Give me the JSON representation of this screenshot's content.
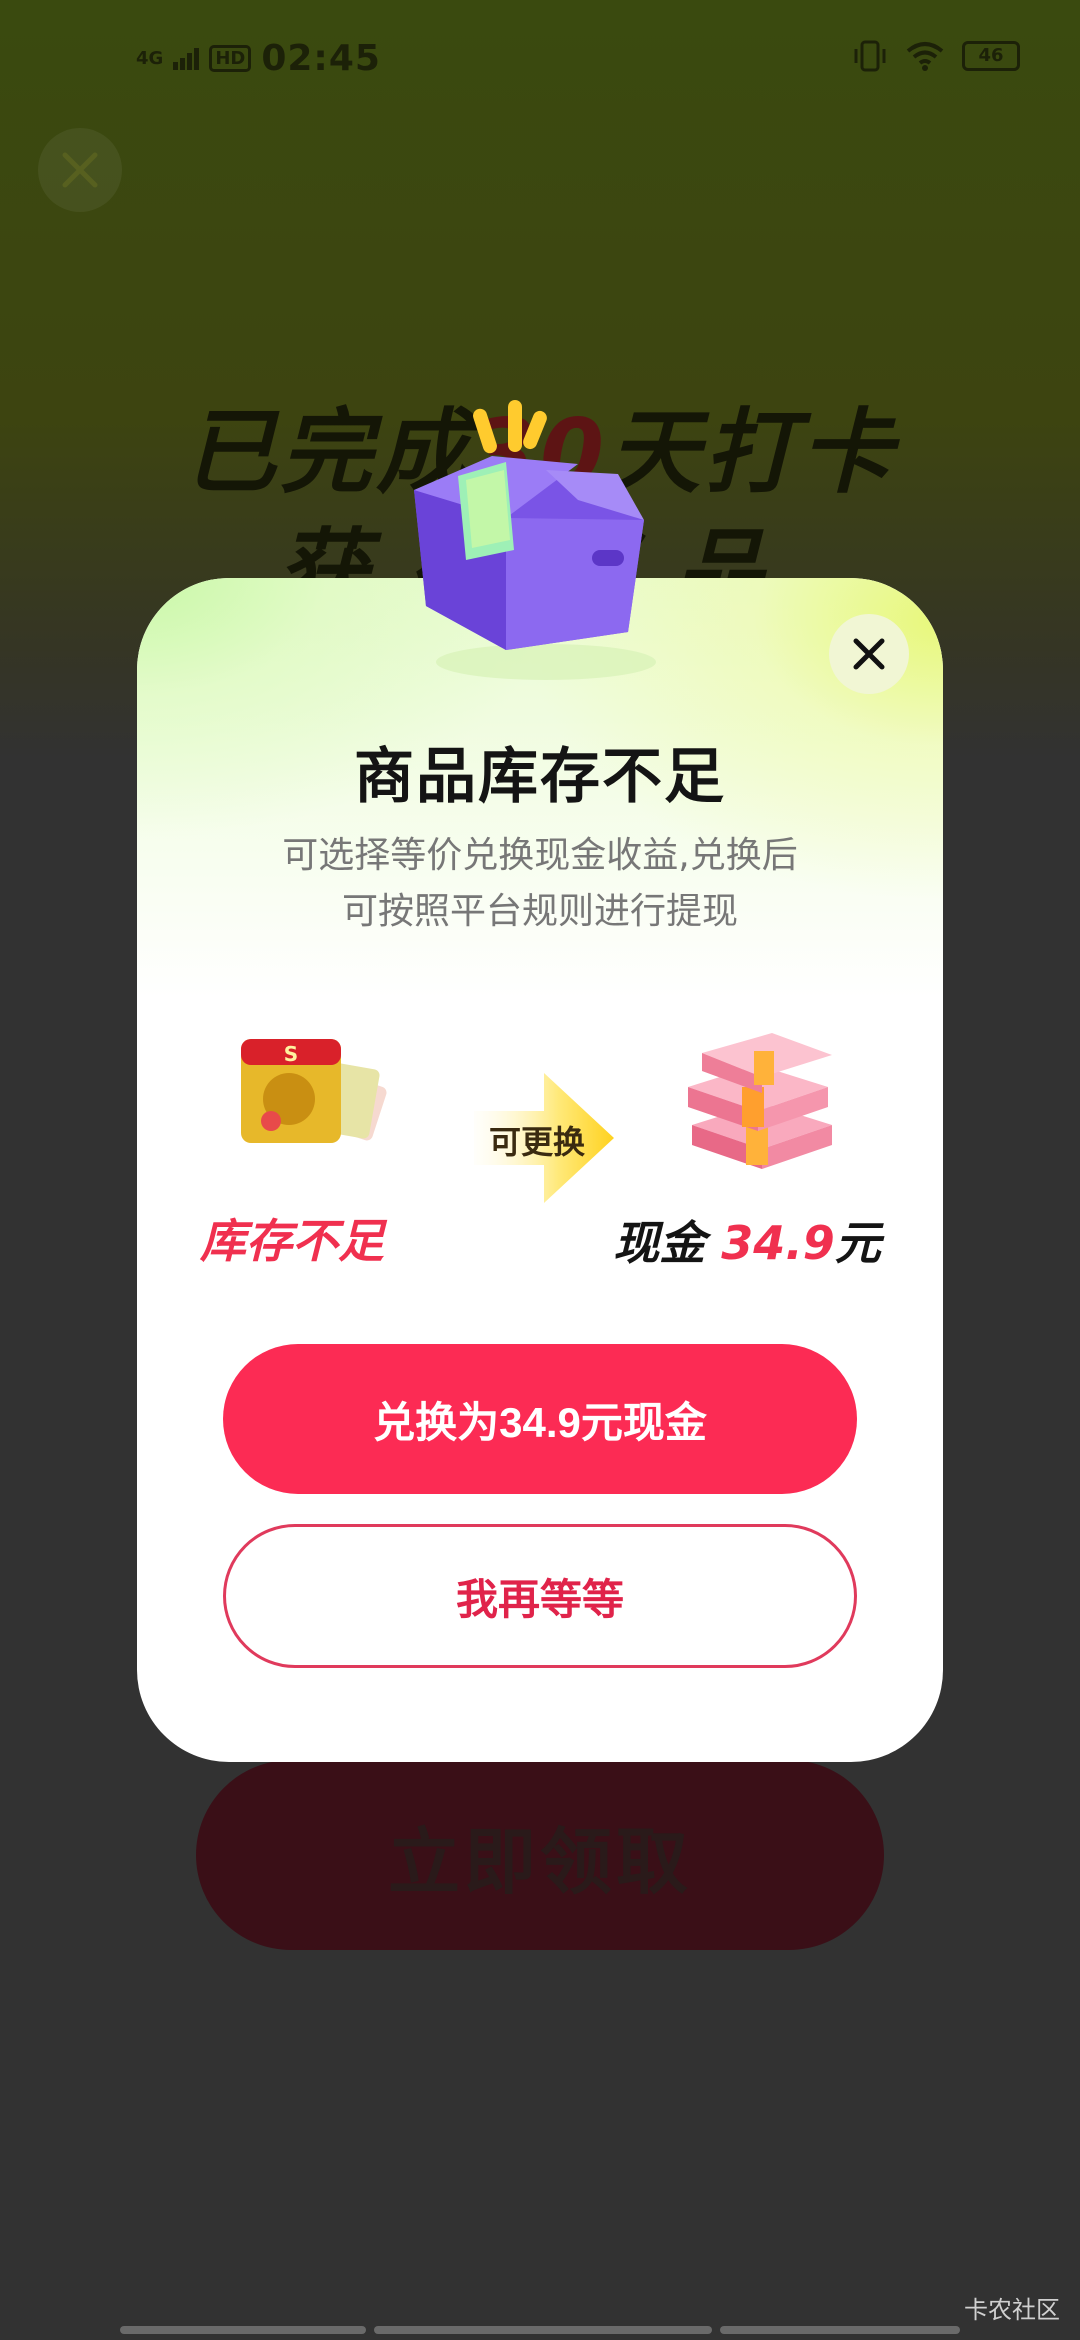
{
  "status_bar": {
    "signal": "4G",
    "hd": "HD",
    "time": "02:45",
    "battery": "46",
    "icons": [
      "signal-icon",
      "vibrate-icon",
      "wifi-icon",
      "battery-icon"
    ]
  },
  "background": {
    "title_prefix": "已完成",
    "title_number": "30",
    "title_suffix": "天打卡",
    "title_line2": "获得奖品",
    "claim_button": "立即领取"
  },
  "modal": {
    "title": "商品库存不足",
    "description_line1": "可选择等价兑换现金收益,兑换后",
    "description_line2": "可按照平台规则进行提现",
    "left_label": "库存不足",
    "arrow_label": "可更换",
    "right_label_prefix": "现金",
    "right_label_amount": "34.9",
    "right_label_suffix": "元",
    "primary_button": "兑换为34.9元现金",
    "secondary_button": "我再等等"
  },
  "watermark": "卡农社区",
  "colors": {
    "accent": "#fc2b54",
    "accent_text": "#f0304f",
    "title_text": "#141414",
    "desc_text": "#777777",
    "overlay_bg": "#323232"
  }
}
